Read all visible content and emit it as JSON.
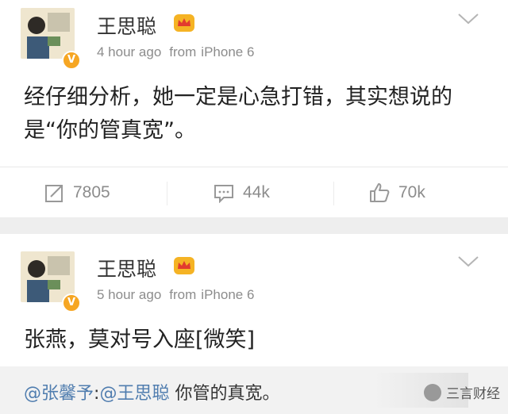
{
  "posts": [
    {
      "author": "王思聪",
      "time": "4 hour ago",
      "from_label": "from",
      "device": "iPhone 6",
      "content": "经仔细分析，她一定是心急打错，其实想说的是“你的管真宽”。",
      "actions": {
        "repost": "7805",
        "comments": "44k",
        "likes": "70k"
      }
    },
    {
      "author": "王思聪",
      "time": "5 hour ago",
      "from_label": "from",
      "device": "iPhone 6",
      "content": "张燕，莫对号入座[微笑]",
      "repost": {
        "mention1": "@张馨予",
        "separator": ":",
        "mention2": "@王思聪",
        "text": " 你管的真宽。"
      }
    }
  ],
  "watermark": "三言财经",
  "colors": {
    "mention": "#507daf",
    "meta": "#8c8c8c",
    "divider": "#eeeeee",
    "verified": "#f6a623"
  }
}
